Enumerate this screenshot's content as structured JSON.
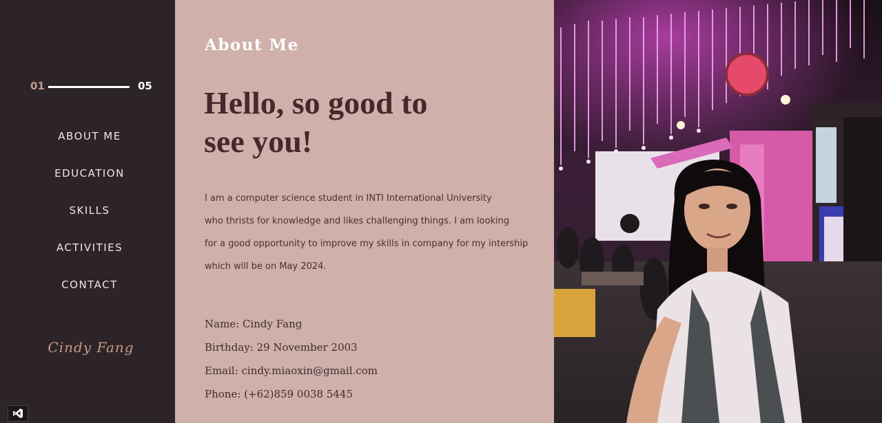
{
  "progress": {
    "start": "01",
    "end": "05"
  },
  "nav": [
    {
      "label": "ABOUT ME"
    },
    {
      "label": "EDUCATION"
    },
    {
      "label": "SKILLS"
    },
    {
      "label": "ACTIVITIES"
    },
    {
      "label": "CONTACT"
    }
  ],
  "signature": "Cindy Fang",
  "about": {
    "section_title": "About Me",
    "headline_line1": "Hello, so good to",
    "headline_line2": "see you!",
    "intro_lines": [
      "I am a computer science student in INTI International University",
      "who thrists for knowledge and likes challenging things. I am looking",
      "for a good opportunity to improve my skills in company for my intership",
      "which will be on May 2024."
    ],
    "details": [
      "Name: Cindy Fang",
      "Birthday: 29 November 2003",
      "Email: cindy.miaoxin@gmail.com",
      "Phone: (+62)859 0038 5445"
    ]
  },
  "photo": {
    "alt": "Cindy Fang portrait"
  },
  "icons": {
    "vs_badge": "visual-studio-icon"
  },
  "colors": {
    "sidebar": "#2c2428",
    "main": "#cfb0aa",
    "accent": "#c49a8f",
    "heading": "#45292c"
  }
}
